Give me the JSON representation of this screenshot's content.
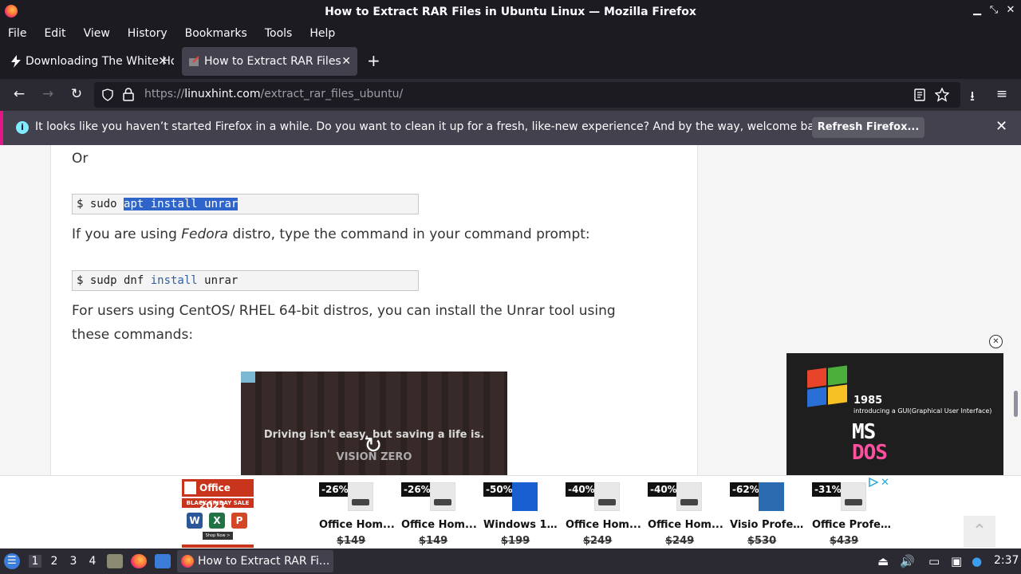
{
  "window": {
    "title": "How to Extract RAR Files in Ubuntu Linux — Mozilla Firefox"
  },
  "menu": [
    "File",
    "Edit",
    "View",
    "History",
    "Bookmarks",
    "Tools",
    "Help"
  ],
  "tabs": [
    {
      "label": "Downloading The White Ho",
      "active": false
    },
    {
      "label": "How to Extract RAR Files",
      "active": true
    }
  ],
  "nav": {
    "url_prefix": "https://",
    "url_domain": "linuxhint.com",
    "url_path": "/extract_rar_files_ubuntu/"
  },
  "notification": {
    "message": "It looks like you haven’t started Firefox in a while. Do you want to clean it up for a fresh, like-new experience? And by the way, welcome back!",
    "button": "Refresh Firefox..."
  },
  "article": {
    "or_text": "Or",
    "code1": {
      "prompt": "$ sudo ",
      "selected": "apt install unrar"
    },
    "fedora_pre": "If you are using ",
    "fedora_em": "Fedora",
    "fedora_post": " distro, type the command in your command prompt:",
    "code2": {
      "prompt": "$ sudp dnf ",
      "kw": "install",
      "rest": " unrar"
    },
    "centos_line1": "For users using CentOS/ RHEL 64-bit distros, you can install the Unrar tool using",
    "centos_line2": "these commands:"
  },
  "video_ad": {
    "line1": "Driving isn't easy, but saving a life is.",
    "line2": "VISION ZERO"
  },
  "side_ad": {
    "year": "1985",
    "intro": "introducing a GUI(Graphical User Interface)",
    "ms": "MS",
    "dos": "DOS"
  },
  "bottom_ad": {
    "office": {
      "title": "Office 2021",
      "sale": "BLACK FRIDAY SALE",
      "shop": "Shop Now >"
    },
    "products": [
      {
        "discount": "-26%",
        "name": "Office Hom...",
        "price": "$149",
        "img": "stick"
      },
      {
        "discount": "-26%",
        "name": "Office Hom...",
        "price": "$149",
        "img": "stick"
      },
      {
        "discount": "-50%",
        "name": "Windows 11...",
        "price": "$199",
        "img": "blue"
      },
      {
        "discount": "-40%",
        "name": "Office Hom...",
        "price": "$249",
        "img": "stick"
      },
      {
        "discount": "-40%",
        "name": "Office Hom...",
        "price": "$249",
        "img": "stick"
      },
      {
        "discount": "-62%",
        "name": "Visio Profes...",
        "price": "$530",
        "img": "visio"
      },
      {
        "discount": "-31%",
        "name": "Office Profe...",
        "price": "$439",
        "img": "stick"
      }
    ]
  },
  "taskbar": {
    "workspaces": [
      "1",
      "2",
      "3",
      "4"
    ],
    "active_task": "How to Extract RAR Fi...",
    "clock": "2:37"
  }
}
